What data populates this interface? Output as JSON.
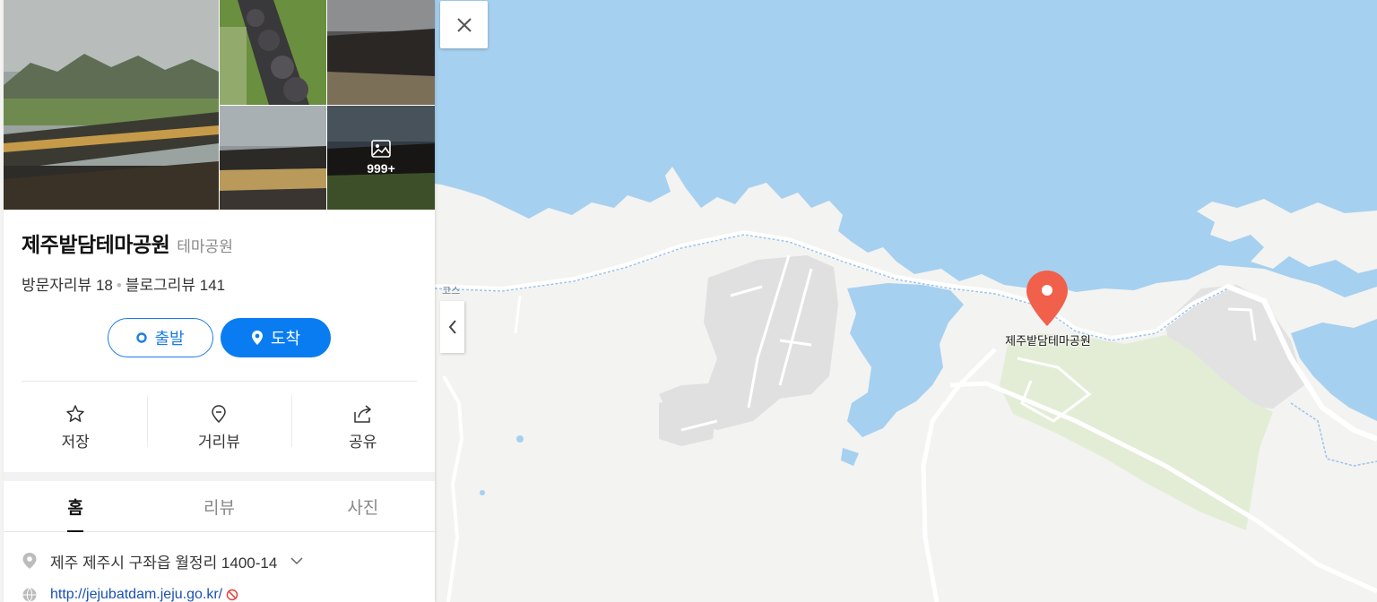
{
  "place": {
    "name": "제주밭담테마공원",
    "category": "테마공원",
    "visitor_review_label": "방문자리뷰",
    "visitor_review_count": "18",
    "blog_review_label": "블로그리뷰",
    "blog_review_count": "141"
  },
  "photos": {
    "more_count": "999+"
  },
  "route": {
    "origin_label": "출발",
    "dest_label": "도착"
  },
  "actions": {
    "save": "저장",
    "streetview": "거리뷰",
    "share": "공유"
  },
  "tabs": [
    "홈",
    "리뷰",
    "사진"
  ],
  "info": {
    "address": "제주 제주시 구좌읍 월정리 1400-14",
    "website": "http://jejubatdam.jeju.go.kr/"
  },
  "map": {
    "marker_label": "제주밭담테마공원",
    "road_label_fragment": "코스",
    "colors": {
      "sea": "#a6d0f0",
      "land": "#f3f3f1",
      "park": "#e3edd6",
      "facility": "#e0e0e0",
      "marker": "#f0604a",
      "accent": "#0a7cf2"
    }
  },
  "icons": [
    "close-icon",
    "chevron-left-icon",
    "pin-icon",
    "star-icon",
    "streetview-icon",
    "share-icon",
    "globe-icon",
    "image-icon",
    "block-icon",
    "chevron-down-icon",
    "location-marker-icon"
  ]
}
